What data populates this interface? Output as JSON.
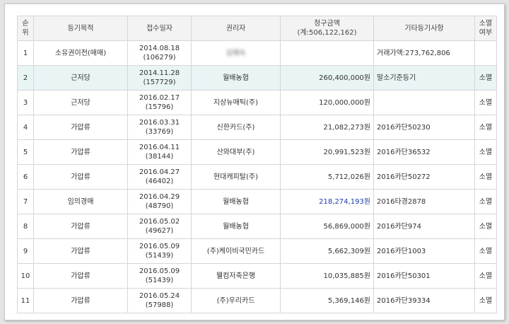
{
  "headers": {
    "no": [
      "순",
      "위"
    ],
    "purpose": "등기목적",
    "date": "접수일자",
    "holder": "권리자",
    "amount_title": "청구금액",
    "amount_total": "(계:506,122,162)",
    "etc": "기타등기사항",
    "extinct": [
      "소멸",
      "여부"
    ]
  },
  "rows": [
    {
      "no": "1",
      "purpose": "소유권이전(매매)",
      "date": "2014.08.18",
      "receipt": "(106279)",
      "holder": "김재숙",
      "holder_blurred": true,
      "amount": "",
      "etc": "거래가액:273,762,806",
      "extinct": ""
    },
    {
      "no": "2",
      "purpose": "근저당",
      "date": "2014.11.28",
      "receipt": "(157729)",
      "holder": "월배농협",
      "amount": "260,400,000원",
      "etc": "말소기준등기",
      "extinct": "소멸"
    },
    {
      "no": "3",
      "purpose": "근저당",
      "date": "2016.02.17",
      "receipt": "(15796)",
      "holder": "지상뉴매틱(주)",
      "amount": "120,000,000원",
      "etc": "",
      "extinct": "소멸"
    },
    {
      "no": "4",
      "purpose": "가압류",
      "date": "2016.03.31",
      "receipt": "(33769)",
      "holder": "신한카드(주)",
      "amount": "21,082,273원",
      "etc": "2016카단50230",
      "extinct": "소멸"
    },
    {
      "no": "5",
      "purpose": "가압류",
      "date": "2016.04.11",
      "receipt": "(38144)",
      "holder": "산와대부(주)",
      "amount": "20,991,523원",
      "etc": "2016카단36532",
      "extinct": "소멸"
    },
    {
      "no": "6",
      "purpose": "가압류",
      "date": "2016.04.27",
      "receipt": "(46402)",
      "holder": "현대캐피탈(주)",
      "amount": "5,712,026원",
      "etc": "2016카단50272",
      "extinct": "소멸"
    },
    {
      "no": "7",
      "purpose": "임의경매",
      "date": "2016.04.29",
      "receipt": "(48790)",
      "holder": "월배농협",
      "amount": "218,274,193원",
      "amount_blue": true,
      "etc": "2016타경2878",
      "extinct": "소멸"
    },
    {
      "no": "8",
      "purpose": "가압류",
      "date": "2016.05.02",
      "receipt": "(49627)",
      "holder": "월배농협",
      "amount": "56,869,000원",
      "etc": "2016카단974",
      "extinct": "소멸"
    },
    {
      "no": "9",
      "purpose": "가압류",
      "date": "2016.05.09",
      "receipt": "(51439)",
      "holder": "(주)케이비국민카드",
      "amount": "5,662,309원",
      "etc": "2016카단1003",
      "extinct": "소멸"
    },
    {
      "no": "10",
      "purpose": "가압류",
      "date": "2016.05.09",
      "receipt": "(51439)",
      "holder": "웰컴저축은행",
      "amount": "10,035,885원",
      "etc": "2016카단50301",
      "extinct": "소멸"
    },
    {
      "no": "11",
      "purpose": "가압류",
      "date": "2016.05.24",
      "receipt": "(57988)",
      "holder": "(주)우리카드",
      "amount": "5,369,146원",
      "etc": "2016카단39334",
      "extinct": "소멸"
    }
  ],
  "colors": {
    "highlight_row": "#e9f4f5",
    "amount_blue": "#1d3aa8",
    "border": "#d6d6d6"
  }
}
